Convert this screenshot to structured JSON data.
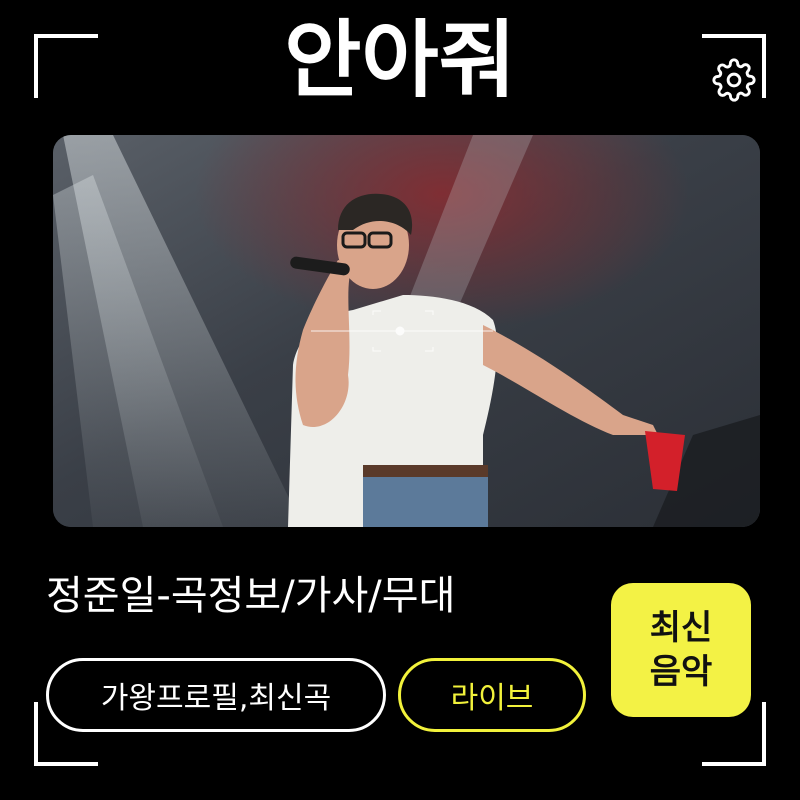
{
  "header": {
    "title": "안아줘"
  },
  "icons": {
    "settings": "gear-icon",
    "focus": "camera-focus-reticle-icon"
  },
  "photo": {
    "description_icon": "concert-photo"
  },
  "song": {
    "title": "정준일-곡정보/가사/무대"
  },
  "buttons": {
    "profile": "가왕프로필,최신곡",
    "live": "라이브"
  },
  "badge": {
    "line1": "최신",
    "line2": "음악"
  },
  "colors": {
    "background": "#000000",
    "accent": "#f3f245",
    "text": "#ffffff"
  }
}
